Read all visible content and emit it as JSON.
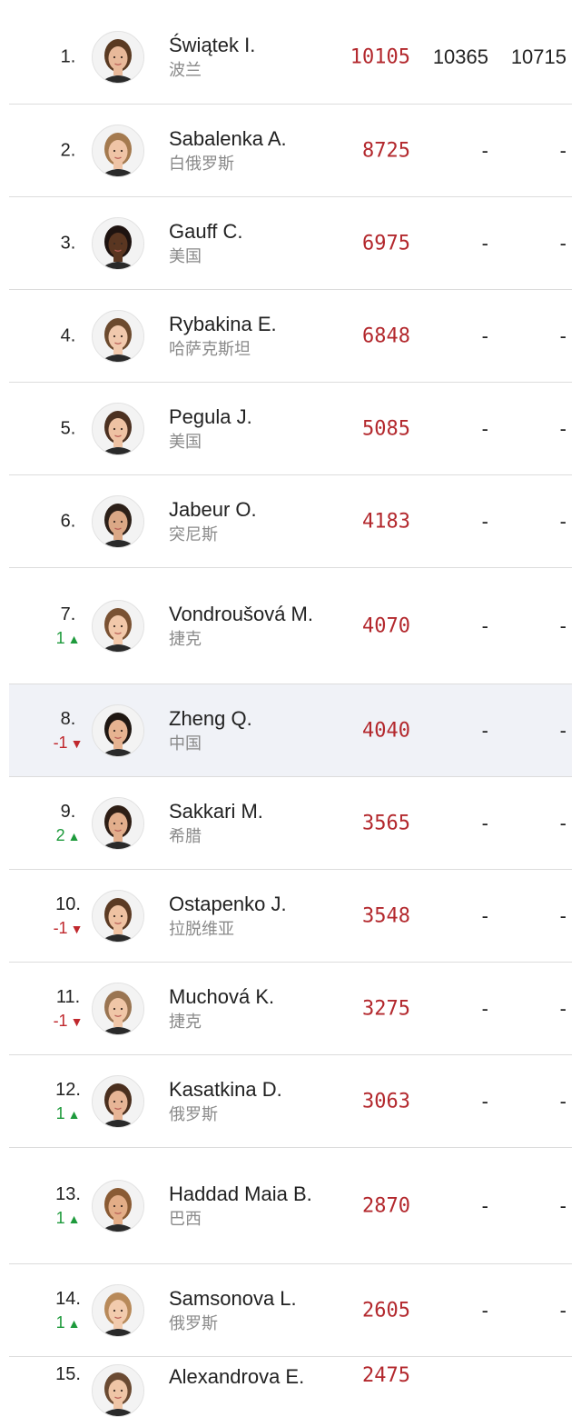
{
  "rankings": [
    {
      "rank": "1.",
      "move": "",
      "dir": "",
      "name": "Świątek I.",
      "country": "波兰",
      "points": "10105",
      "col2": "10365",
      "col3": "10715",
      "hair": "#5a3a22",
      "skin": "#e8b99a",
      "h": 103
    },
    {
      "rank": "2.",
      "move": "",
      "dir": "",
      "name": "Sabalenka A.",
      "country": "白俄罗斯",
      "points": "8725",
      "col2": "-",
      "col3": "-",
      "hair": "#a47a4f",
      "skin": "#efc4a6",
      "h": 102
    },
    {
      "rank": "3.",
      "move": "",
      "dir": "",
      "name": "Gauff C.",
      "country": "美国",
      "points": "6975",
      "col2": "-",
      "col3": "-",
      "hair": "#1e1310",
      "skin": "#5a3621",
      "h": 102
    },
    {
      "rank": "4.",
      "move": "",
      "dir": "",
      "name": "Rybakina E.",
      "country": "哈萨克斯坦",
      "points": "6848",
      "col2": "-",
      "col3": "-",
      "hair": "#6c4a2e",
      "skin": "#f1c9ad",
      "h": 102
    },
    {
      "rank": "5.",
      "move": "",
      "dir": "",
      "name": "Pegula J.",
      "country": "美国",
      "points": "5085",
      "col2": "-",
      "col3": "-",
      "hair": "#4c3121",
      "skin": "#eec2a3",
      "h": 102
    },
    {
      "rank": "6.",
      "move": "",
      "dir": "",
      "name": "Jabeur O.",
      "country": "突尼斯",
      "points": "4183",
      "col2": "-",
      "col3": "-",
      "hair": "#2c2019",
      "skin": "#dba886",
      "h": 102
    },
    {
      "rank": "7.",
      "move": "1",
      "dir": "up",
      "name": "Vondroušová M.",
      "country": "捷克",
      "points": "4070",
      "col2": "-",
      "col3": "-",
      "hair": "#7a5233",
      "skin": "#f2c8aa",
      "h": 128
    },
    {
      "rank": "8.",
      "move": "-1",
      "dir": "down",
      "name": "Zheng Q.",
      "country": "中国",
      "points": "4040",
      "col2": "-",
      "col3": "-",
      "hair": "#1f1712",
      "skin": "#e6b391",
      "h": 102,
      "highlight": true
    },
    {
      "rank": "9.",
      "move": "2",
      "dir": "up",
      "name": "Sakkari M.",
      "country": "希腊",
      "points": "3565",
      "col2": "-",
      "col3": "-",
      "hair": "#2e1e15",
      "skin": "#e2ae8c",
      "h": 102
    },
    {
      "rank": "10.",
      "move": "-1",
      "dir": "down",
      "name": "Ostapenko J.",
      "country": "拉脱维亚",
      "points": "3548",
      "col2": "-",
      "col3": "-",
      "hair": "#5c3b24",
      "skin": "#efc2a2",
      "h": 102
    },
    {
      "rank": "11.",
      "move": "-1",
      "dir": "down",
      "name": "Muchová K.",
      "country": "捷克",
      "points": "3275",
      "col2": "-",
      "col3": "-",
      "hair": "#9a7552",
      "skin": "#f0c6a7",
      "h": 102
    },
    {
      "rank": "12.",
      "move": "1",
      "dir": "up",
      "name": "Kasatkina D.",
      "country": "俄罗斯",
      "points": "3063",
      "col2": "-",
      "col3": "-",
      "hair": "#4a2f1e",
      "skin": "#e7b596",
      "h": 102
    },
    {
      "rank": "13.",
      "move": "1",
      "dir": "up",
      "name": "Haddad Maia B.",
      "country": "巴西",
      "points": "2870",
      "col2": "-",
      "col3": "-",
      "hair": "#8a5b34",
      "skin": "#e3ad87",
      "h": 128
    },
    {
      "rank": "14.",
      "move": "1",
      "dir": "up",
      "name": "Samsonova L.",
      "country": "俄罗斯",
      "points": "2605",
      "col2": "-",
      "col3": "-",
      "hair": "#b88a5a",
      "skin": "#f2cbad",
      "h": 102
    },
    {
      "rank": "15.",
      "move": "",
      "dir": "",
      "name": "Alexandrova E.",
      "country": "",
      "points": "2475",
      "col2": "",
      "col3": "",
      "hair": "#6a4a32",
      "skin": "#efc5a6",
      "h": 60
    }
  ],
  "colors": {
    "points": "#b3282d",
    "up": "#1e9a3c",
    "down": "#c0282d",
    "highlight_row": "#f0f2f7"
  }
}
